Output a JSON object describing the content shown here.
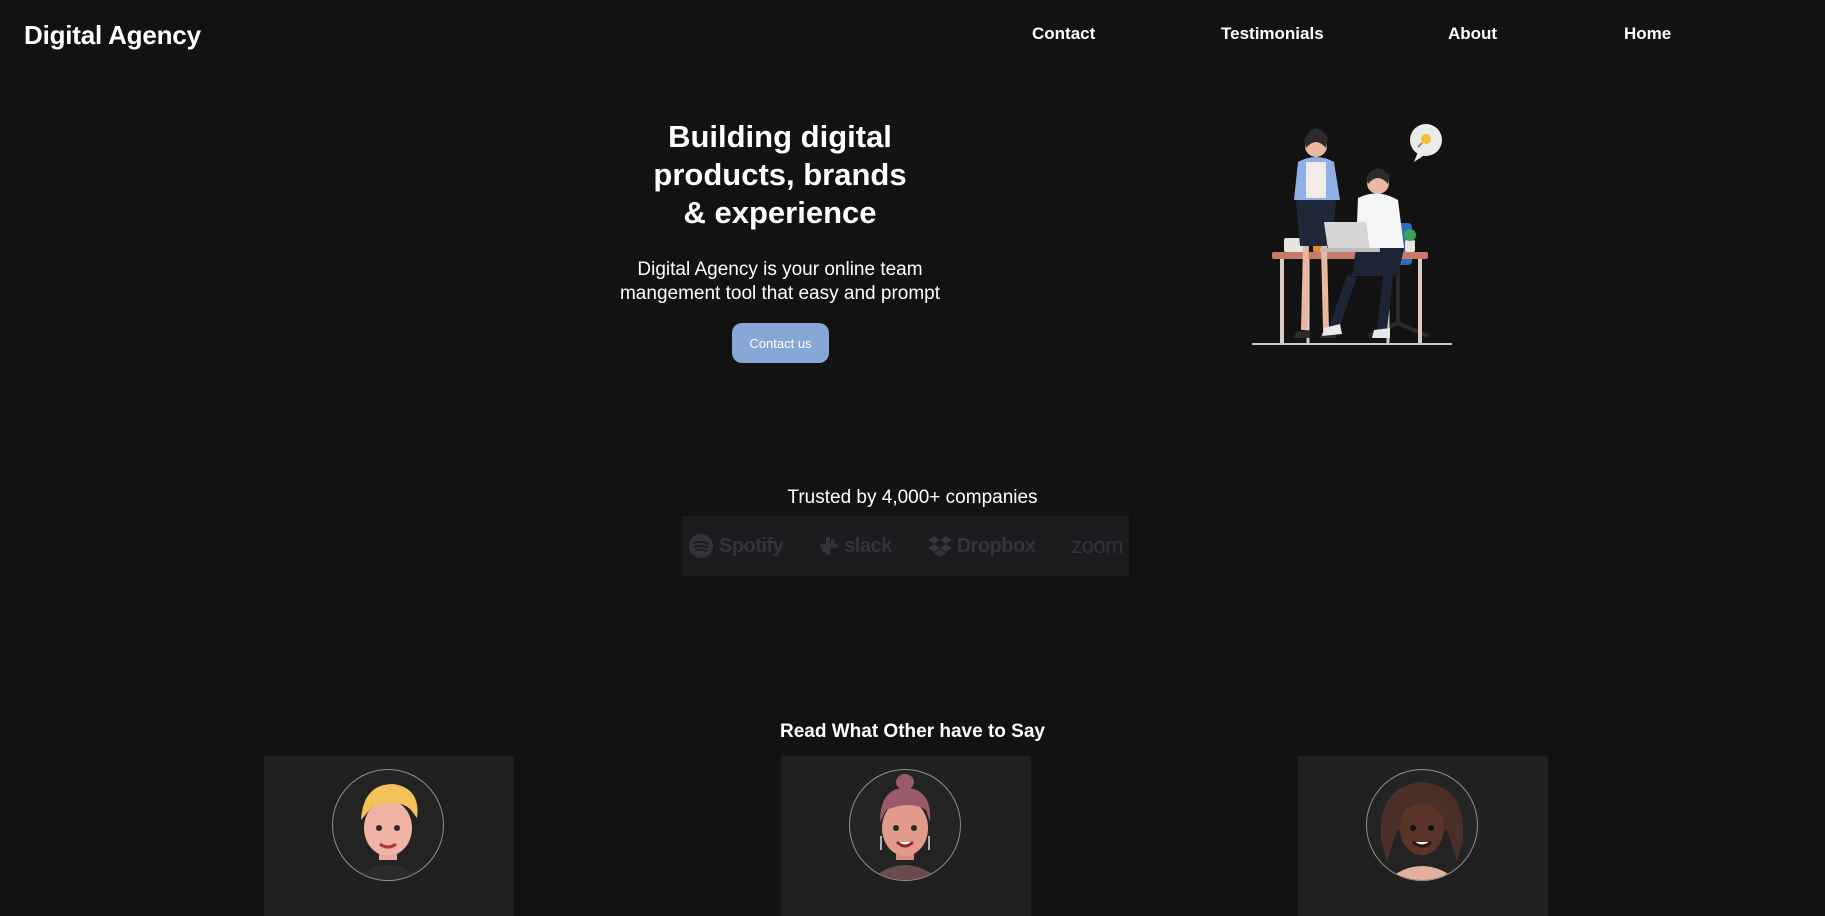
{
  "header": {
    "brand": "Digital Agency",
    "nav": [
      {
        "label": "Contact"
      },
      {
        "label": "Testimonials"
      },
      {
        "label": "About"
      },
      {
        "label": "Home"
      }
    ]
  },
  "hero": {
    "title_lines": [
      "Building digital",
      "products, brands",
      "& experience"
    ],
    "subtitle_lines": [
      "Digital Agency is your online team",
      "mangement tool that easy and prompt"
    ],
    "cta_label": "Contact us",
    "cta_color": "#87a7d6"
  },
  "trusted": {
    "text": "Trusted by 4,000+ companies",
    "logos": [
      {
        "name": "Spotify",
        "icon": "spotify-logo"
      },
      {
        "name": "slack",
        "icon": "slack-logo"
      },
      {
        "name": "Dropbox",
        "icon": "dropbox-logo"
      },
      {
        "name": "zoom",
        "icon": "zoom-logo"
      }
    ]
  },
  "testimonials": {
    "heading": "Read What Other have to Say",
    "cards": [
      {
        "avatar": "blond-man-avatar"
      },
      {
        "avatar": "woman-with-earrings-avatar"
      },
      {
        "avatar": "man-with-dreadlocks-avatar"
      }
    ]
  },
  "colors": {
    "background": "#121212",
    "card": "#202020",
    "logo_strip": "#1c1c1e",
    "logo_text": "#32333f"
  }
}
